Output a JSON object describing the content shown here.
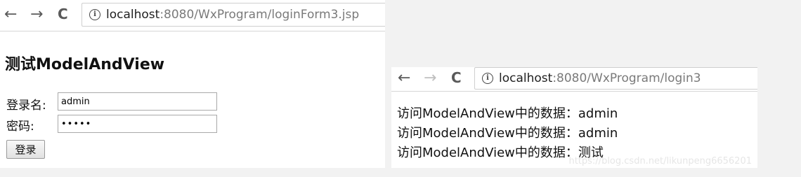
{
  "left_window": {
    "url_host": "localhost",
    "url_path": ":8080/WxProgram/loginForm3.jsp",
    "title": "测试ModelAndView",
    "username_label": "登录名:",
    "username_value": "admin",
    "password_label": "密码:",
    "password_masked": "•••••",
    "submit_label": "登录"
  },
  "right_window": {
    "url_host": "localhost",
    "url_path": ":8080/WxProgram/login3",
    "lines": [
      "访问ModelAndView中的数据：admin",
      "访问ModelAndView中的数据：admin",
      "访问ModelAndView中的数据：测试"
    ]
  },
  "nav": {
    "back_glyph": "←",
    "forward_glyph": "→",
    "reload_glyph": "C",
    "info_glyph": "i"
  },
  "watermark": "https://blog.csdn.net/likunpeng6656201",
  "colors": {
    "page_background": "#f2f2f2",
    "url_path_gray": "#7a7a7a",
    "text": "#111111"
  }
}
